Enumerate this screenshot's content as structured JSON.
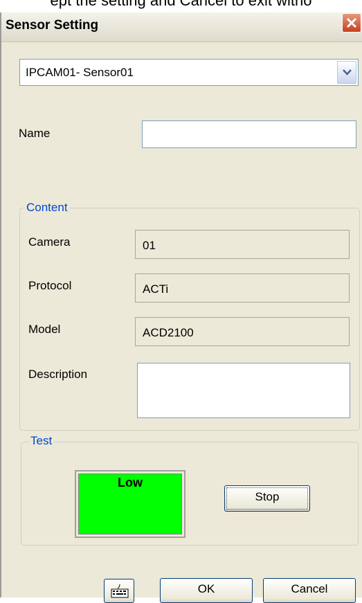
{
  "caption": "ept the setting and Cancel to exit witho",
  "dialog": {
    "title": "Sensor Setting",
    "sensor_select": {
      "selected": "IPCAM01- Sensor01"
    },
    "name": {
      "label": "Name",
      "value": ""
    },
    "content_group": {
      "legend": "Content",
      "camera": {
        "label": "Camera",
        "value": "01"
      },
      "protocol": {
        "label": "Protocol",
        "value": "ACTi"
      },
      "model": {
        "label": "Model",
        "value": "ACD2100"
      },
      "description": {
        "label": "Description",
        "value": ""
      }
    },
    "test_group": {
      "legend": "Test",
      "status": "Low",
      "status_color": "#00ff00",
      "stop_label": "Stop"
    },
    "buttons": {
      "ok": "OK",
      "cancel": "Cancel"
    },
    "icons": {
      "close": "close-icon",
      "dropdown": "chevron-down-icon",
      "keyboard": "keyboard-icon"
    }
  }
}
